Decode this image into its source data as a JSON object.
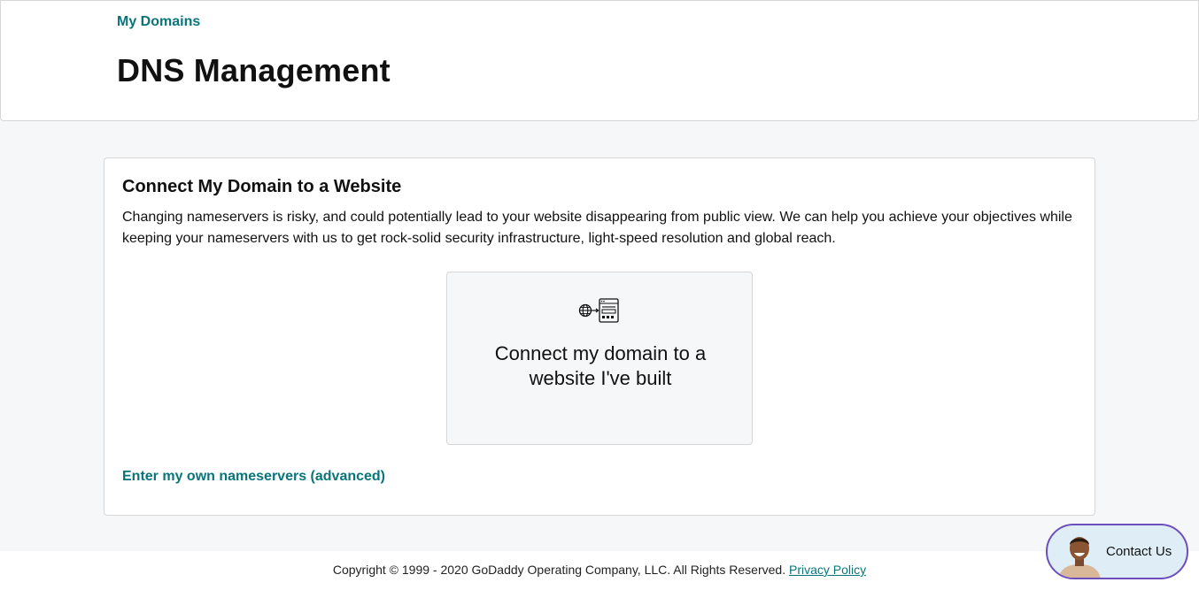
{
  "header": {
    "breadcrumb": "My Domains",
    "title": "DNS Management"
  },
  "card": {
    "title": "Connect My Domain to a Website",
    "description": "Changing nameservers is risky, and could potentially lead to your website disappearing from public view. We can help you achieve your objectives while keeping your nameservers with us to get rock-solid security infrastructure, light-speed resolution and global reach.",
    "option_tile": {
      "icon": "globe-to-website-icon",
      "label": "Connect my domain to a website I've built"
    },
    "advanced_link": "Enter my own nameservers (advanced)"
  },
  "footer": {
    "copyright": "Copyright © 1999 - 2020 GoDaddy Operating Company, LLC. All Rights Reserved.",
    "privacy_link": "Privacy Policy"
  },
  "contact": {
    "label": "Contact Us",
    "avatar_icon": "support-agent-avatar"
  },
  "colors": {
    "accent": "#09757a",
    "background": "#f5f7f8",
    "contact_border": "#6b4fbb",
    "contact_bg": "#dfeef6"
  }
}
